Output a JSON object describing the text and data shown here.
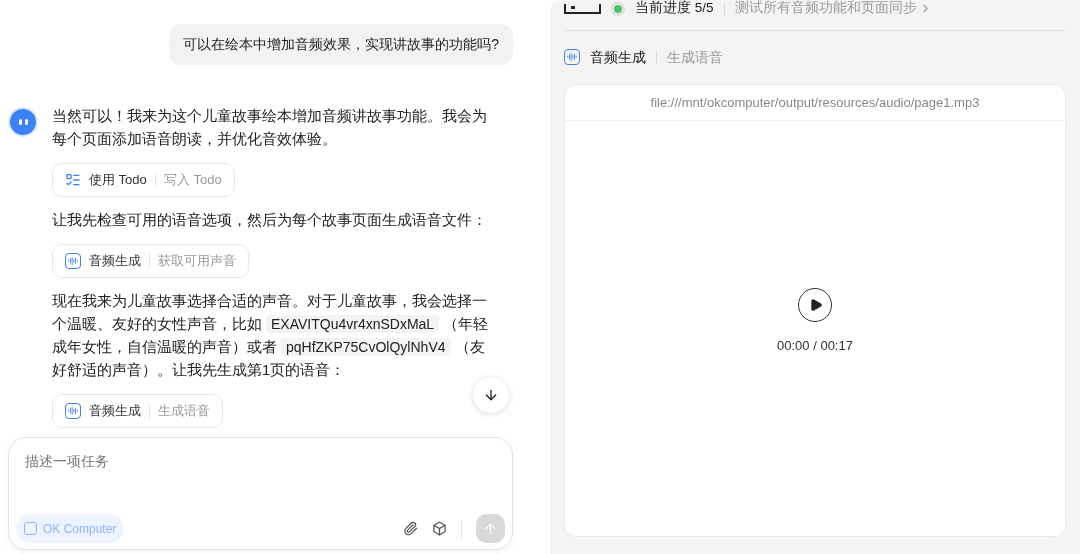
{
  "chat": {
    "user_message": "可以在绘本中增加音频效果，实现讲故事的功能吗?",
    "blocks": [
      {
        "kind": "text",
        "segments": [
          {
            "kind": "plain",
            "text": "当然可以！我来为这个儿童故事绘本增加音频讲故事功能。我会为每个页面添加语音朗读，并优化音效体验。"
          }
        ]
      },
      {
        "kind": "todo_tool",
        "name": "使用 Todo",
        "action": "写入 Todo"
      },
      {
        "kind": "text",
        "segments": [
          {
            "kind": "plain",
            "text": "让我先检查可用的语音选项，然后为每个故事页面生成语音文件："
          }
        ]
      },
      {
        "kind": "audio_tool",
        "name": "音频生成",
        "action": "获取可用声音"
      },
      {
        "kind": "text",
        "segments": [
          {
            "kind": "plain",
            "text": "现在我来为儿童故事选择合适的声音。对于儿童故事，我会选择一个温暖、友好的女性声音，比如"
          },
          {
            "kind": "code",
            "text": "EXAVITQu4vr4xnSDxMaL"
          },
          {
            "kind": "plain",
            "text": "（年轻成年女性，自信温暖的声音）或者"
          },
          {
            "kind": "code",
            "text": "pqHfZKP75CvOlQylNhV4"
          },
          {
            "kind": "plain",
            "text": "（友好舒适的声音）。让我先生成第1页的语音："
          }
        ]
      },
      {
        "kind": "audio_tool",
        "name": "音频生成",
        "action": "生成语音"
      }
    ],
    "input": {
      "placeholder": "描述一项任务",
      "mode_chip": "OK Computer"
    }
  },
  "panel": {
    "progress": {
      "label": "当前进度 5/5",
      "task": "测试所有音频功能和页面同步",
      "done": true
    },
    "tool": {
      "name": "音频生成",
      "action": "生成语音"
    },
    "player": {
      "path": "file:///mnt/okcomputer/output/resources/audio/page1.mp3",
      "time": "00:00 / 00:17"
    }
  }
}
